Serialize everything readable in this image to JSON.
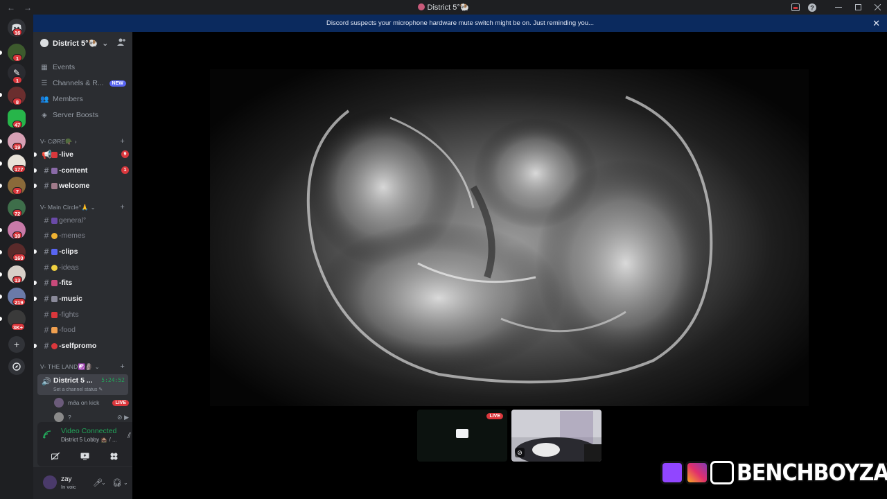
{
  "window": {
    "title": "District 5°🐏",
    "nav": [
      "←",
      "→"
    ],
    "controls": [
      "inbox",
      "help",
      "minimize",
      "maximize",
      "close"
    ]
  },
  "notice": {
    "text": "Discord suspects your microphone hardware mute switch might be on. Just reminding you...",
    "close": "✕"
  },
  "rail": {
    "home_badge": "16",
    "servers": [
      {
        "badge": "1",
        "color": "#3d5a2d"
      },
      {
        "badge": "1",
        "color": "#2a2b30"
      },
      {
        "badge": "8",
        "color": "#6a2e2e"
      },
      {
        "badge": "47",
        "color": "#27b54a"
      },
      {
        "badge": "19",
        "color": "#d7a0b4"
      },
      {
        "badge": "177",
        "color": "#e8e2d8"
      },
      {
        "badge": "7",
        "color": "#8a6a3a"
      },
      {
        "badge": "72",
        "color": "#3e6e4a"
      },
      {
        "badge": "10",
        "color": "#c87aa8"
      },
      {
        "badge": "160",
        "color": "#5a2a2a"
      },
      {
        "badge": "13",
        "color": "#d8d0c8"
      },
      {
        "badge": "219",
        "color": "#6a7aa8"
      },
      {
        "badge": "3K+",
        "color": "#3a3a3a"
      }
    ]
  },
  "server": {
    "name": "District 5°🐏",
    "menu": [
      {
        "icon": "calendar-icon",
        "label": "Events"
      },
      {
        "icon": "channels-icon",
        "label": "Channels & R...",
        "badge": "NEW"
      },
      {
        "icon": "members-icon",
        "label": "Members"
      },
      {
        "icon": "boost-icon",
        "label": "Server Boosts"
      }
    ],
    "categories": [
      {
        "name": "V- CØRE🪖 ›",
        "channels": [
          {
            "name": "-live",
            "bold": true,
            "emoji_color": "#da373c",
            "mention": "9",
            "unread": true
          },
          {
            "name": "-content",
            "bold": true,
            "emoji_color": "#8a6aa8",
            "mention": "1",
            "unread": true
          },
          {
            "name": "welcome",
            "bold": true,
            "emoji_color": "#a07a8a",
            "unread": true
          }
        ]
      },
      {
        "name": "V- Main Circle°🙏 ⌄",
        "channels": [
          {
            "name": "general°",
            "bold": false,
            "emoji_color": "#6a4aa8"
          },
          {
            "name": "-memes",
            "bold": false,
            "emoji_color": "#f0b232"
          },
          {
            "name": "-clips",
            "bold": true,
            "emoji_color": "#5865f2",
            "unread": true
          },
          {
            "name": "-ideas",
            "bold": false,
            "emoji_color": "#f0d040"
          },
          {
            "name": "-fits",
            "bold": true,
            "emoji_color": "#c84a7a",
            "unread": true
          },
          {
            "name": "-music",
            "bold": true,
            "emoji_color": "#8a8a9a",
            "unread": true
          },
          {
            "name": "-fights",
            "bold": false,
            "emoji_color": "#da373c"
          },
          {
            "name": "-food",
            "bold": false,
            "emoji_color": "#f0a050"
          },
          {
            "name": "-selfpromo",
            "bold": true,
            "emoji_color": "#da373c",
            "unread": true
          }
        ]
      },
      {
        "name": "V- THE LAND☯️🗿 ⌄",
        "voice": {
          "name": "District 5 ...",
          "time": "5:24:52",
          "status": "Set a channel status ✎",
          "users": [
            {
              "name": "mða on kick",
              "live": "LIVE"
            },
            {
              "name": "?",
              "live": ""
            }
          ]
        }
      }
    ]
  },
  "voice_panel": {
    "title": "Video Connected",
    "subtitle": "District 5 Lobby 🏚️ / ..."
  },
  "user": {
    "name": "zay",
    "status": "In voic"
  },
  "stage": {
    "tiles": [
      {
        "live": "LIVE"
      },
      {
        "live": ""
      }
    ],
    "brand": "BENCHBOYZAY"
  }
}
